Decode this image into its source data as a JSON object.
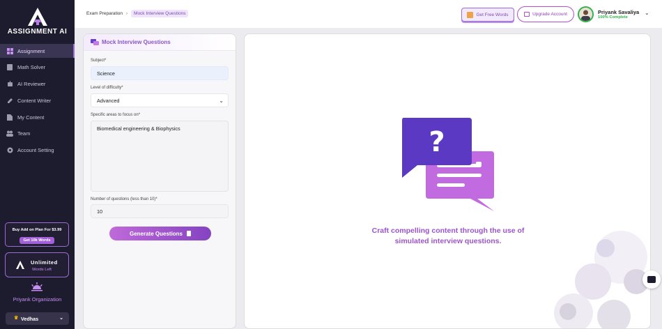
{
  "brand": {
    "name": "ASSIGNMENT AI"
  },
  "sidebar": {
    "items": [
      {
        "label": "Assignment",
        "icon": "grid-icon",
        "active": true
      },
      {
        "label": "Math Solver",
        "icon": "calculator-icon"
      },
      {
        "label": "AI Reviewer",
        "icon": "robot-icon"
      },
      {
        "label": "Content Writer",
        "icon": "pen-icon"
      },
      {
        "label": "My Content",
        "icon": "document-icon"
      },
      {
        "label": "Team",
        "icon": "people-icon"
      },
      {
        "label": "Account Setting",
        "icon": "gear-icon"
      }
    ],
    "promo": {
      "text": "Buy Add on Plan For $3.99",
      "button": "Get 10k Words"
    },
    "words": {
      "title": "Unlimited",
      "subtitle": "Words Left"
    },
    "organization": "Priyank Organization",
    "workspace": "Vedhas"
  },
  "header": {
    "breadcrumb": [
      "Exam Preparation",
      "Mock Interview Questions"
    ],
    "free_words": "Get Free Words",
    "upgrade": "Upgrade Account",
    "user": {
      "name": "Priyank Savaliya",
      "status": "100% Complete"
    }
  },
  "form": {
    "title": "Mock Interview Questions",
    "subject": {
      "label": "Subject*",
      "value": "Science"
    },
    "difficulty": {
      "label": "Level of difficulty*",
      "value": "Advanced"
    },
    "focus": {
      "label": "Specific areas to focus on*",
      "value": "Biomedical engineering & Biophysics"
    },
    "count": {
      "label": "Number of questions (less than 10)*",
      "value": "10"
    },
    "submit": "Generate Questions"
  },
  "result": {
    "line1": "Craft compelling content through the use of",
    "line2": "simulated interview questions."
  },
  "colors": {
    "accent": "#9b55c9",
    "sidebar": "#1d1b2e"
  }
}
